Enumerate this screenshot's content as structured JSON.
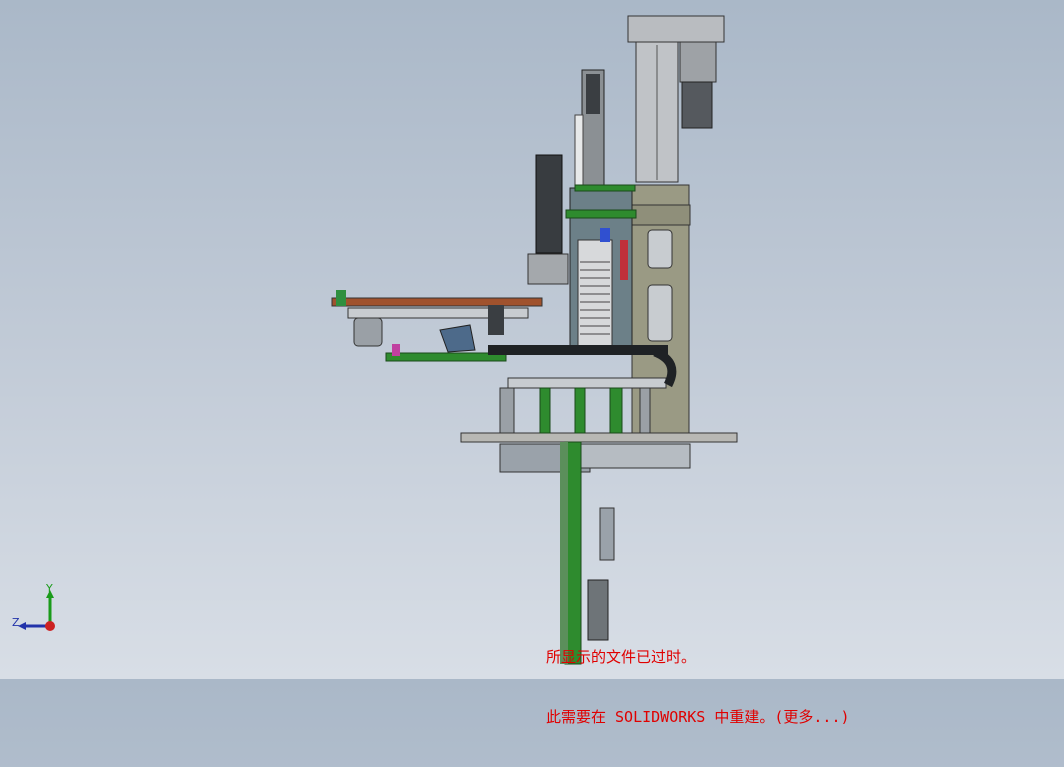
{
  "viewport": {
    "background_top": "#aab8c8",
    "background_bottom": "#d8dee6",
    "model_name": "assembly-machine-model"
  },
  "rebuild_message": {
    "line1": "所显示的文件已过时。",
    "line2": "此需要在 SOLIDWORKS 中重建。(更多...)",
    "color": "#e00000"
  },
  "triad": {
    "y_label": "Y",
    "z_label": "Z",
    "x_color": "#cc2222",
    "y_color": "#1a9b1a",
    "z_color": "#2233aa"
  }
}
